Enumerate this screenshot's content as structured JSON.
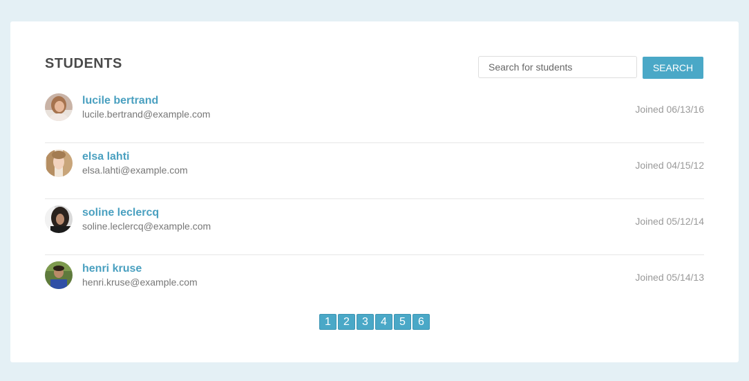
{
  "header": {
    "title": "STUDENTS"
  },
  "search": {
    "placeholder": "Search for students",
    "value": "",
    "button_label": "SEARCH"
  },
  "colors": {
    "page_background": "#e4f0f5",
    "accent": "#4aa8c7",
    "name_link": "#4aa0c0",
    "muted_text": "#999999"
  },
  "students": [
    {
      "name": "lucile bertrand",
      "email": "lucile.bertrand@example.com",
      "joined": "Joined 06/13/16"
    },
    {
      "name": "elsa lahti",
      "email": "elsa.lahti@example.com",
      "joined": "Joined 04/15/12"
    },
    {
      "name": "soline leclercq",
      "email": "soline.leclercq@example.com",
      "joined": "Joined 05/12/14"
    },
    {
      "name": "henri kruse",
      "email": "henri.kruse@example.com",
      "joined": "Joined 05/14/13"
    }
  ],
  "pagination": {
    "pages": [
      "1",
      "2",
      "3",
      "4",
      "5",
      "6"
    ]
  }
}
